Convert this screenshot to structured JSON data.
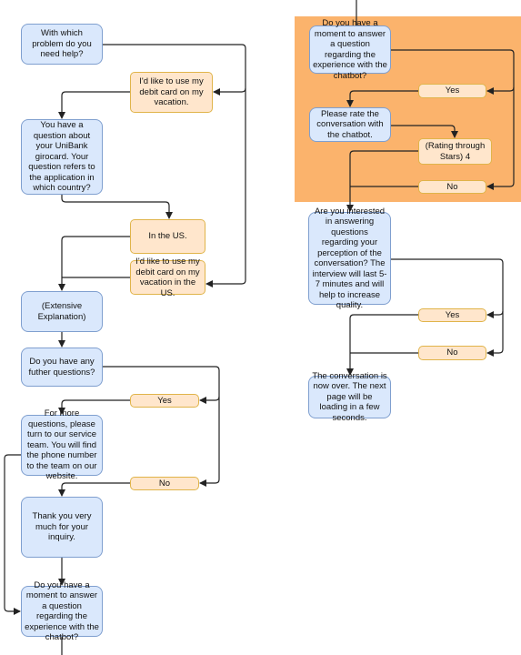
{
  "colors": {
    "question_fill": "#dae8fc",
    "answer_fill": "#ffe6cc",
    "group_background": "#fbb36c",
    "connector": "#222222"
  },
  "left_flow": {
    "q_problem": "With which problem do you need help?",
    "a_vacation": "I'd like to use my debit card on my vacation.",
    "q_country": "You have a question about your UniBank girocard. Your question refers to the application in which country?",
    "a_us": "In the US.",
    "a_vacation_us": "I'd like to use my debit card on my vacation in the US.",
    "explanation": "(Extensive Explanation)",
    "q_further": "Do you have any futher questions?",
    "a_yes": "Yes",
    "service_team": "For more questions, please turn to our service team. You will find the phone number to the team on our website.",
    "a_no": "No",
    "thanks": "Thank you very much for your inquiry.",
    "q_moment": "Do you have a moment to answer a question regarding the experience with the chatbot?"
  },
  "right_flow": {
    "q_moment": "Do you have a moment to answer a question regarding the experience with the chatbot?",
    "a_yes": "Yes",
    "rate": "Please rate the conversation with the chatbot.",
    "rating": "(Rating through Stars) 4",
    "a_no": "No",
    "q_interview": "Are you interested in answering questions regarding your perception of the conversation? The interview will last 5-7 minutes and will help to increase quality.",
    "a_yes2": "Yes",
    "a_no2": "No",
    "end": "The conversation is now over. The next page will be loading in a few seconds."
  }
}
